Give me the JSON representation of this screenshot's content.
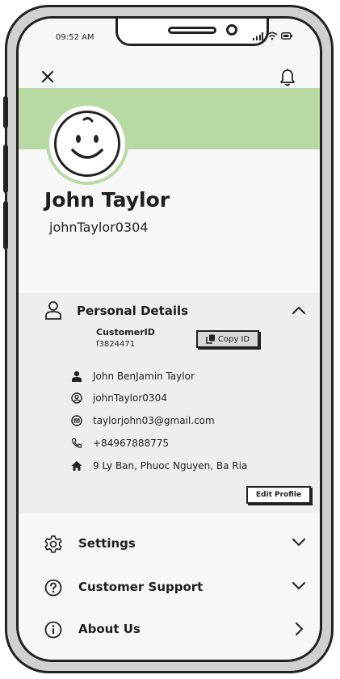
{
  "status_bar": {
    "time": "09:52 AM"
  },
  "profile": {
    "name": "John Taylor",
    "username": "johnTaylor0304"
  },
  "personal_details": {
    "title": "Personal Details",
    "customer_id_label": "CustomerID",
    "customer_id_value": "f3824471",
    "copy_button_label": "Copy ID",
    "full_name": "John BenJamin Taylor",
    "username": "johnTaylor0304",
    "email": "taylorjohn03@gmail.com",
    "phone": "+84967888775",
    "address": "9 Ly Ban, Phuoc Nguyen, Ba Ria",
    "edit_button_label": "Edit Profile"
  },
  "menu": [
    {
      "label": "Settings",
      "icon": "gear-icon"
    },
    {
      "label": "Customer Support",
      "icon": "question-icon"
    },
    {
      "label": "About Us",
      "icon": "info-icon"
    }
  ],
  "colors": {
    "banner": "#b9d9a5",
    "details_bg": "#eeeeee"
  }
}
